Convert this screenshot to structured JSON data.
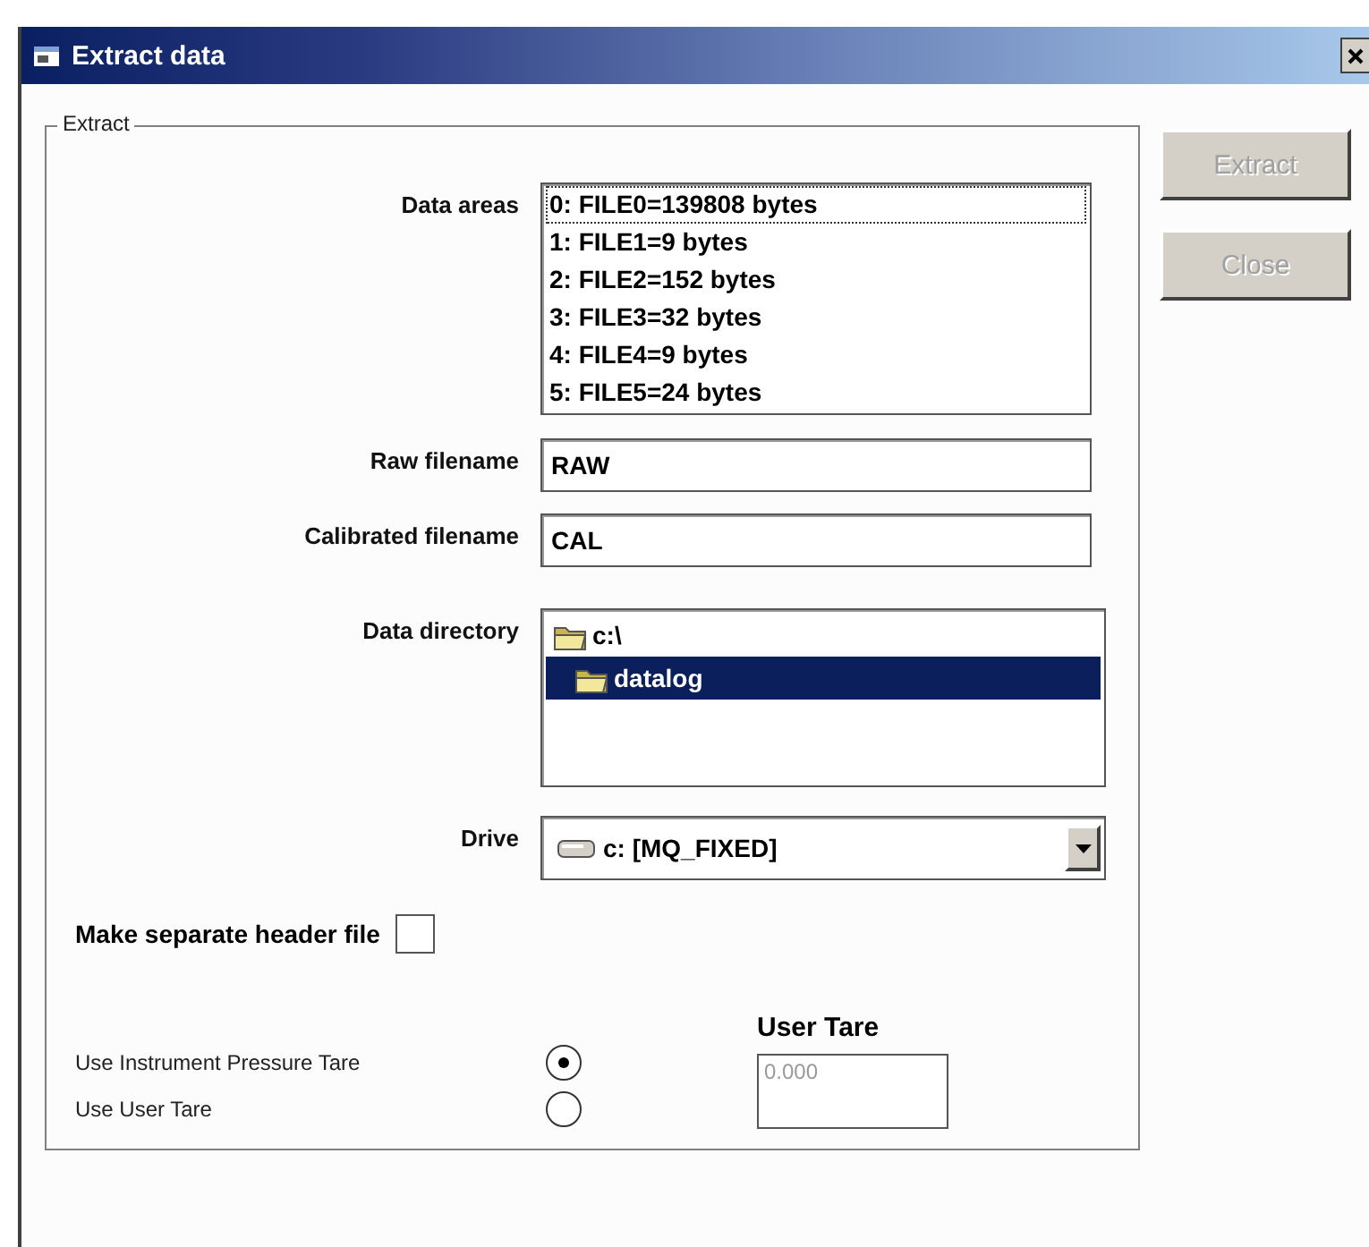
{
  "window": {
    "title": "Extract data"
  },
  "group": {
    "legend": "Extract"
  },
  "data_areas": {
    "label": "Data areas",
    "items": [
      {
        "text": "0: FILE0=139808 bytes",
        "selected": false,
        "focused": true
      },
      {
        "text": "1: FILE1=9 bytes",
        "selected": false,
        "focused": false
      },
      {
        "text": "2: FILE2=152 bytes",
        "selected": false,
        "focused": false
      },
      {
        "text": "3: FILE3=32 bytes",
        "selected": false,
        "focused": false
      },
      {
        "text": "4: FILE4=9 bytes",
        "selected": false,
        "focused": false
      },
      {
        "text": "5: FILE5=24 bytes",
        "selected": false,
        "focused": false
      }
    ]
  },
  "raw_filename": {
    "label": "Raw filename",
    "value": "RAW"
  },
  "calibrated_filename": {
    "label": "Calibrated filename",
    "value": "CAL"
  },
  "data_directory": {
    "label": "Data directory",
    "items": [
      {
        "text": "c:\\",
        "selected": false,
        "children": [
          {
            "text": "datalog",
            "selected": true
          }
        ]
      }
    ]
  },
  "drive": {
    "label": "Drive",
    "value": "c: [MQ_FIXED]"
  },
  "header_file": {
    "label": "Make separate header file",
    "checked": false
  },
  "tare_options": [
    {
      "label": "Use Instrument Pressure Tare",
      "selected": true
    },
    {
      "label": "Use User Tare",
      "selected": false
    }
  ],
  "user_tare": {
    "label": "User Tare",
    "value": "0.000",
    "disabled": true
  },
  "buttons": [
    {
      "label": "Extract",
      "disabled": true
    },
    {
      "label": "Close",
      "disabled": true
    }
  ]
}
